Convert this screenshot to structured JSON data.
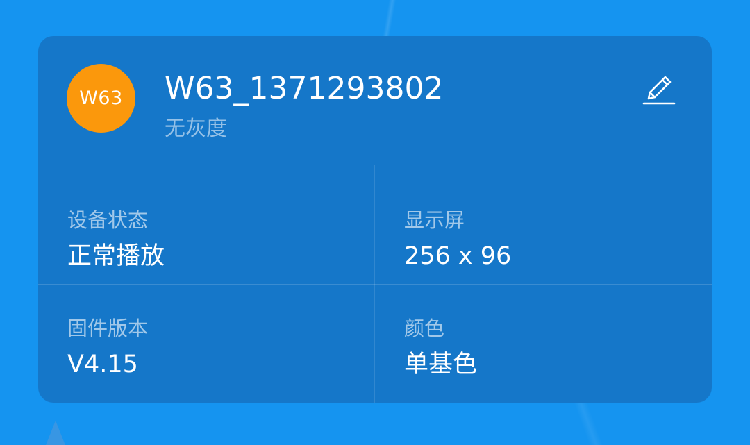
{
  "device": {
    "avatar_text": "W63",
    "name": "W63_1371293802",
    "subtitle": "无灰度",
    "edit_icon": "pencil-edit-icon"
  },
  "info": {
    "status_label": "设备状态",
    "status_value": "正常播放",
    "display_label": "显示屏",
    "display_value": "256 x 96",
    "firmware_label": "固件版本",
    "firmware_value": "V4.15",
    "color_label": "颜色",
    "color_value": "单基色"
  },
  "colors": {
    "background": "#1594f0",
    "card": "#1577c9",
    "avatar": "#fb980c",
    "text_primary": "#ffffff"
  }
}
